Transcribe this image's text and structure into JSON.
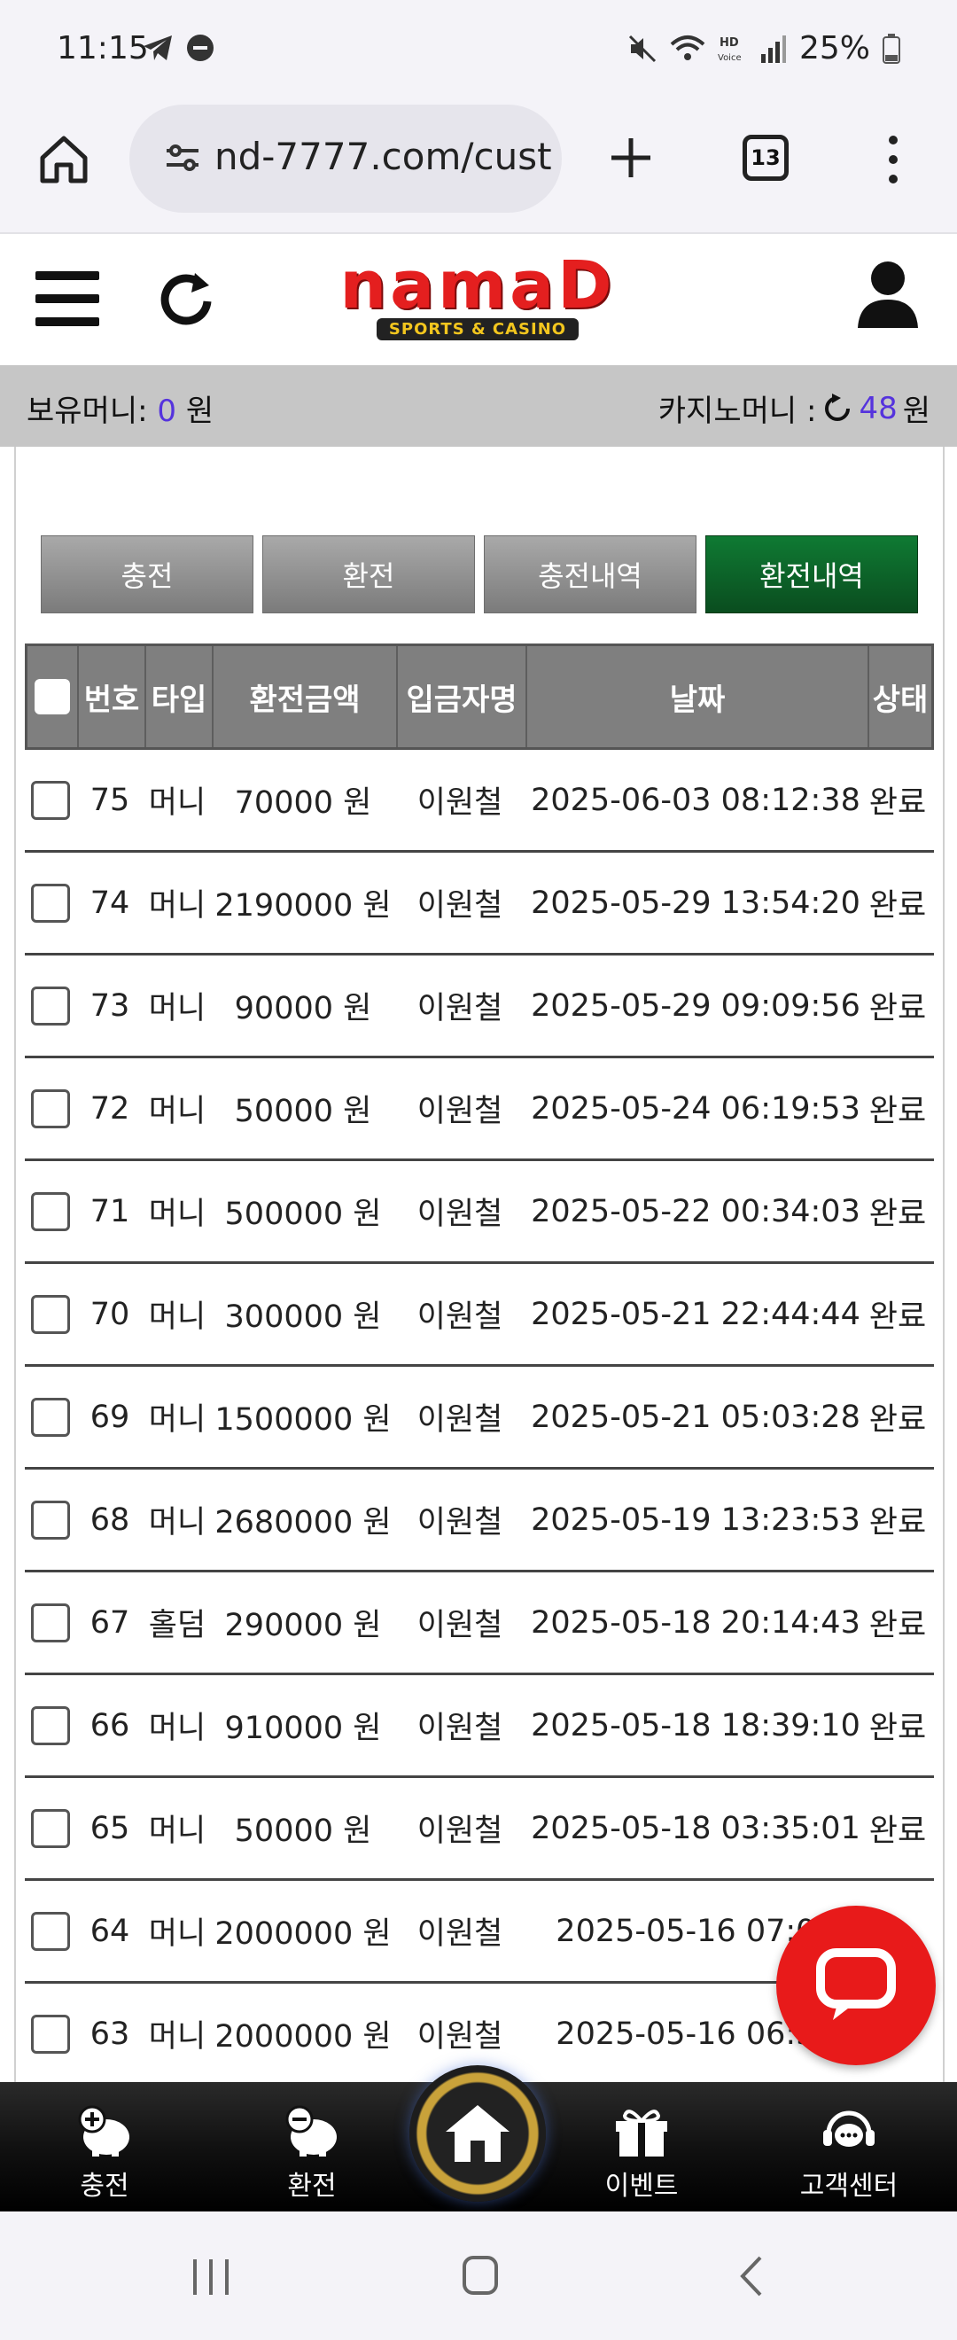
{
  "status_bar": {
    "time": "11:15",
    "battery": "25%",
    "icons": [
      "telegram-icon",
      "dnd-icon",
      "mute-icon",
      "wifi-icon",
      "hd-voice-icon",
      "signal-icon",
      "battery-icon"
    ]
  },
  "browser": {
    "url": "nd-7777.com/cust",
    "tab_count": "13",
    "icons": [
      "home-icon",
      "site-info-icon",
      "new-tab-icon",
      "tabs-icon",
      "menu-icon"
    ]
  },
  "header": {
    "logo_text": "namaD",
    "logo_sub": "SPORTS & CASINO",
    "brand_color": "#e41f1f"
  },
  "money": {
    "held_label": "보유머니:",
    "held_value": "0",
    "held_unit": "원",
    "casino_label": "카지노머니 :",
    "casino_value": "48",
    "casino_unit": "원",
    "value_color": "#5533dd"
  },
  "tabs": [
    {
      "label": "충전",
      "active": false
    },
    {
      "label": "환전",
      "active": false
    },
    {
      "label": "충전내역",
      "active": false
    },
    {
      "label": "환전내역",
      "active": true
    }
  ],
  "table": {
    "columns": [
      "번호",
      "타입",
      "환전금액",
      "입금자명",
      "날짜",
      "상태"
    ],
    "rows": [
      {
        "no": "75",
        "type": "머니",
        "amount": "70000 원",
        "name": "이원철",
        "date": "2025-06-03 08:12:38",
        "status": "완료"
      },
      {
        "no": "74",
        "type": "머니",
        "amount": "2190000 원",
        "name": "이원철",
        "date": "2025-05-29 13:54:20",
        "status": "완료"
      },
      {
        "no": "73",
        "type": "머니",
        "amount": "90000 원",
        "name": "이원철",
        "date": "2025-05-29 09:09:56",
        "status": "완료"
      },
      {
        "no": "72",
        "type": "머니",
        "amount": "50000 원",
        "name": "이원철",
        "date": "2025-05-24 06:19:53",
        "status": "완료"
      },
      {
        "no": "71",
        "type": "머니",
        "amount": "500000 원",
        "name": "이원철",
        "date": "2025-05-22 00:34:03",
        "status": "완료"
      },
      {
        "no": "70",
        "type": "머니",
        "amount": "300000 원",
        "name": "이원철",
        "date": "2025-05-21 22:44:44",
        "status": "완료"
      },
      {
        "no": "69",
        "type": "머니",
        "amount": "1500000 원",
        "name": "이원철",
        "date": "2025-05-21 05:03:28",
        "status": "완료"
      },
      {
        "no": "68",
        "type": "머니",
        "amount": "2680000 원",
        "name": "이원철",
        "date": "2025-05-19 13:23:53",
        "status": "완료"
      },
      {
        "no": "67",
        "type": "홀덤",
        "amount": "290000 원",
        "name": "이원철",
        "date": "2025-05-18 20:14:43",
        "status": "완료"
      },
      {
        "no": "66",
        "type": "머니",
        "amount": "910000 원",
        "name": "이원철",
        "date": "2025-05-18 18:39:10",
        "status": "완료"
      },
      {
        "no": "65",
        "type": "머니",
        "amount": "50000 원",
        "name": "이원철",
        "date": "2025-05-18 03:35:01",
        "status": "완료"
      },
      {
        "no": "64",
        "type": "머니",
        "amount": "2000000 원",
        "name": "이원철",
        "date": "2025-05-16 07:03",
        "status": ""
      },
      {
        "no": "63",
        "type": "머니",
        "amount": "2000000 원",
        "name": "이원철",
        "date": "2025-05-16 06:53",
        "status": ""
      }
    ]
  },
  "bottom_nav": [
    {
      "label": "충전",
      "icon": "piggy-plus-icon"
    },
    {
      "label": "환전",
      "icon": "piggy-minus-icon"
    },
    {
      "label": "",
      "icon": "home-icon"
    },
    {
      "label": "이벤트",
      "icon": "gift-icon"
    },
    {
      "label": "고객센터",
      "icon": "headset-icon"
    }
  ],
  "chat_button": {
    "icon": "chat-icon",
    "color": "#e81a1a"
  }
}
